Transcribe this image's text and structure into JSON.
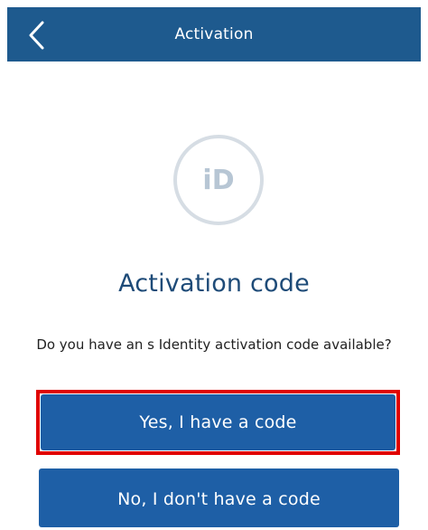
{
  "header": {
    "title": "Activation",
    "back_icon": "chevron-left-icon"
  },
  "logo": {
    "text": "iD",
    "icon": "identity-logo-icon"
  },
  "content": {
    "heading": "Activation code",
    "question": "Do you have an s Identity activation code available?"
  },
  "buttons": {
    "yes_label": "Yes, I have a code",
    "no_label": "No, I don't have a code"
  },
  "colors": {
    "header_bg": "#1e5a8e",
    "button_bg": "#1e5fa6",
    "heading_text": "#1e4b78",
    "highlight": "#e00000",
    "logo_ring": "#d6dde4",
    "logo_text": "#b7c6d4"
  }
}
